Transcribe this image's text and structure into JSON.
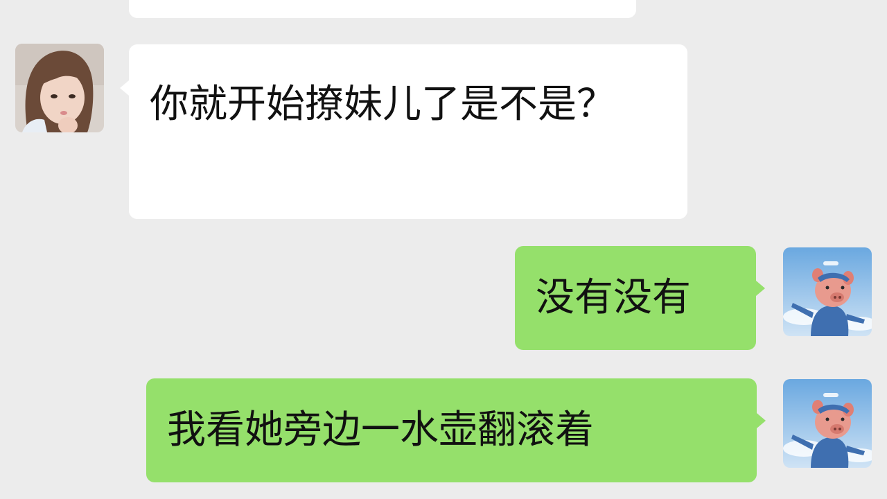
{
  "messages": [
    {
      "sender": "contact",
      "text": "你就开始撩妹儿了是不是？"
    },
    {
      "sender": "me",
      "text": "没有没有"
    },
    {
      "sender": "me",
      "text": "我看她旁边一水壶翻滚着"
    }
  ],
  "colors": {
    "background": "#ececec",
    "incoming_bubble": "#ffffff",
    "outgoing_bubble": "#95e06b"
  },
  "icons": {
    "contact_avatar": "girl-photo-avatar",
    "my_avatar": "pig-toy-avatar"
  }
}
